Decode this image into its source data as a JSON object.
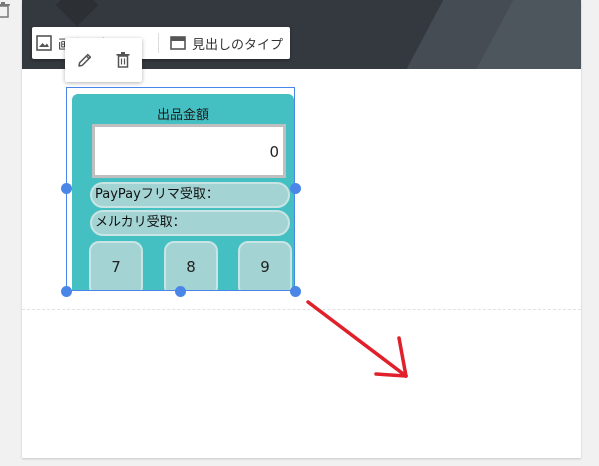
{
  "toolbar": {
    "change_image_label": "画像を変更",
    "heading_type_label": "見出しのタイプ"
  },
  "calculator": {
    "title": "出品金額",
    "display_value": "0",
    "paypay_label": "PayPayフリマ受取：",
    "mercari_label": "メルカリ受取：",
    "keys": [
      "7",
      "8",
      "9"
    ]
  },
  "colors": {
    "calc_background": "#45c0c2",
    "key_background": "#a3d3d3",
    "selection": "#4a86e8",
    "annotation_arrow": "#e0202a"
  }
}
